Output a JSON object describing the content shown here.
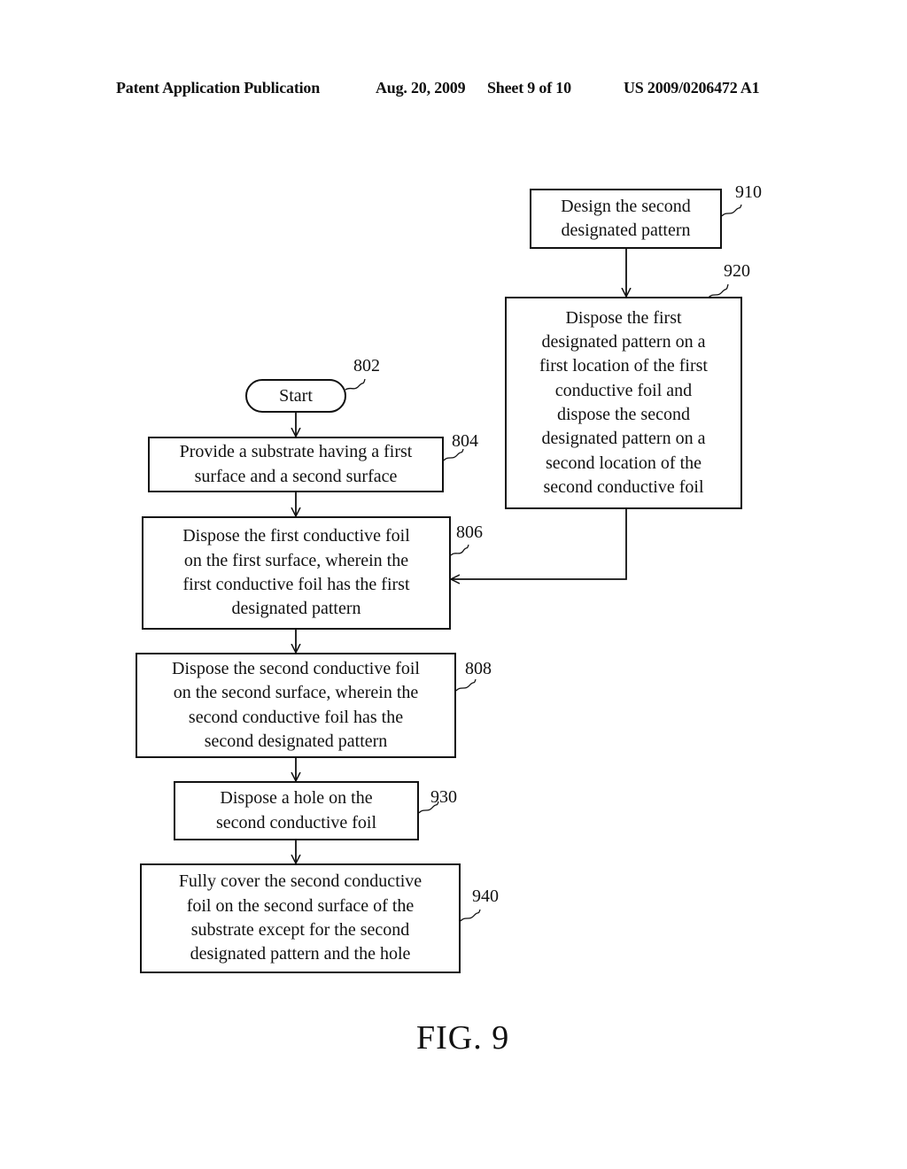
{
  "header": {
    "publication": "Patent Application Publication",
    "date": "Aug. 20, 2009",
    "sheet": "Sheet 9 of 10",
    "number": "US 2009/0206472 A1"
  },
  "figure_label": "FIG. 9",
  "flowchart": {
    "start": {
      "ref": "802",
      "label": "Start"
    },
    "steps": [
      {
        "ref": "804",
        "lines": [
          "Provide a substrate having a first",
          "surface and a second surface"
        ]
      },
      {
        "ref": "806",
        "lines": [
          "Dispose the first conductive foil",
          "on the first surface, wherein the",
          "first conductive foil has the first",
          "designated pattern"
        ]
      },
      {
        "ref": "808",
        "lines": [
          "Dispose the second conductive foil",
          "on the second surface, wherein the",
          "second conductive foil has the",
          "second designated pattern"
        ]
      },
      {
        "ref": "930",
        "lines": [
          "Dispose a hole on the",
          "second conductive foil"
        ]
      },
      {
        "ref": "940",
        "lines": [
          "Fully cover the second conductive",
          "foil on the second surface of the",
          "substrate except for the second",
          "designated pattern and the hole"
        ]
      }
    ],
    "branch": [
      {
        "ref": "910",
        "lines": [
          "Design the second",
          "designated pattern"
        ]
      },
      {
        "ref": "920",
        "lines": [
          "Dispose the first",
          "designated pattern on a",
          "first location of the first",
          "conductive foil and",
          "dispose the second",
          "designated pattern on a",
          "second location of the",
          "second conductive foil"
        ]
      }
    ]
  }
}
